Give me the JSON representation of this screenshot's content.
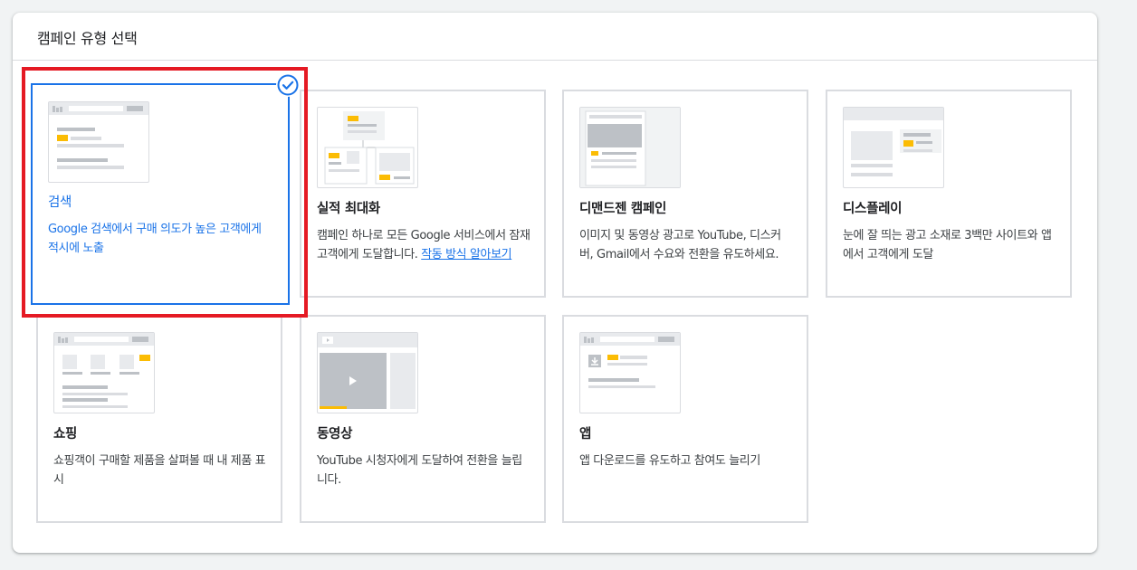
{
  "panel": {
    "title": "캠페인 유형 선택"
  },
  "cards": [
    {
      "title": "검색",
      "description": "Google 검색에서 구매 의도가 높은 고객에게 적시에 노출",
      "selected": true
    },
    {
      "title": "실적 최대화",
      "description": "캠페인 하나로 모든 Google 서비스에서 잠재고객에게 도달합니다. ",
      "link": "작동 방식 알아보기"
    },
    {
      "title": "디맨드젠 캠페인",
      "description": "이미지 및 동영상 광고로 YouTube, 디스커버, Gmail에서 수요와 전환을 유도하세요."
    },
    {
      "title": "디스플레이",
      "description": "눈에 잘 띄는 광고 소재로 3백만 사이트와 앱에서 고객에게 도달"
    },
    {
      "title": "쇼핑",
      "description": "쇼핑객이 구매할 제품을 살펴볼 때 내 제품 표시"
    },
    {
      "title": "동영상",
      "description": "YouTube 시청자에게 도달하여 전환을 늘립니다."
    },
    {
      "title": "앱",
      "description": "앱 다운로드를 유도하고 참여도 늘리기"
    }
  ],
  "icons": {
    "selected_check": "check-circle-icon"
  },
  "colors": {
    "accent_blue": "#1a73e8",
    "highlight_red": "#e51a24",
    "thumb_yellow": "#fbbc04",
    "thumb_gray": "#dadce0"
  }
}
